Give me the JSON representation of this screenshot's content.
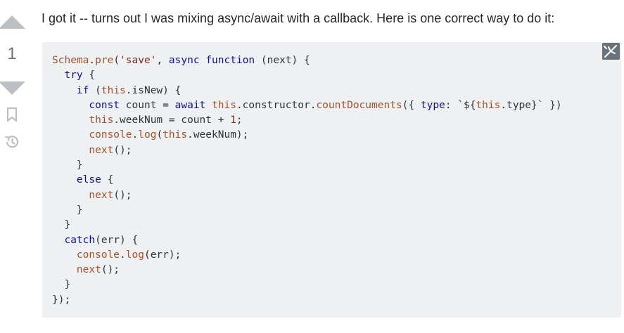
{
  "vote": {
    "count": "1"
  },
  "answer": {
    "intro": "I got it -- turns out I was mixing async/await with a callback. Here is one correct way to do it:"
  },
  "code": {
    "lines": [
      [
        [
          "fn",
          "Schema"
        ],
        [
          "v",
          "."
        ],
        [
          "fn",
          "pre"
        ],
        [
          "v",
          "("
        ],
        [
          "s",
          "'save'"
        ],
        [
          "v",
          ", "
        ],
        [
          "k",
          "async"
        ],
        [
          "v",
          " "
        ],
        [
          "k",
          "function"
        ],
        [
          "v",
          " (next) {"
        ]
      ],
      [
        [
          "v",
          "  "
        ],
        [
          "k",
          "try"
        ],
        [
          "v",
          " {"
        ]
      ],
      [
        [
          "v",
          "    "
        ],
        [
          "k",
          "if"
        ],
        [
          "v",
          " ("
        ],
        [
          "b",
          "this"
        ],
        [
          "v",
          ".isNew) {"
        ]
      ],
      [
        [
          "v",
          "      "
        ],
        [
          "k",
          "const"
        ],
        [
          "v",
          " count = "
        ],
        [
          "k",
          "await"
        ],
        [
          "v",
          " "
        ],
        [
          "b",
          "this"
        ],
        [
          "v",
          ".constructor."
        ],
        [
          "fn",
          "countDocuments"
        ],
        [
          "v",
          "({ "
        ],
        [
          "k",
          "type"
        ],
        [
          "v",
          ": `${"
        ],
        [
          "b",
          "this"
        ],
        [
          "v",
          ".type}` })"
        ]
      ],
      [
        [
          "v",
          "      "
        ],
        [
          "b",
          "this"
        ],
        [
          "v",
          ".weekNum = count + "
        ],
        [
          "n",
          "1"
        ],
        [
          "v",
          ";"
        ]
      ],
      [
        [
          "v",
          "      "
        ],
        [
          "fn",
          "console"
        ],
        [
          "v",
          "."
        ],
        [
          "fn",
          "log"
        ],
        [
          "v",
          "("
        ],
        [
          "b",
          "this"
        ],
        [
          "v",
          ".weekNum);"
        ]
      ],
      [
        [
          "v",
          "      "
        ],
        [
          "fn",
          "next"
        ],
        [
          "v",
          "();"
        ]
      ],
      [
        [
          "v",
          "    }"
        ]
      ],
      [
        [
          "v",
          "    "
        ],
        [
          "k",
          "else"
        ],
        [
          "v",
          " {"
        ]
      ],
      [
        [
          "v",
          "      "
        ],
        [
          "fn",
          "next"
        ],
        [
          "v",
          "();"
        ]
      ],
      [
        [
          "v",
          "    }"
        ]
      ],
      [
        [
          "v",
          "  }"
        ]
      ],
      [
        [
          "v",
          "  "
        ],
        [
          "k",
          "catch"
        ],
        [
          "v",
          "(err) {"
        ]
      ],
      [
        [
          "v",
          "    "
        ],
        [
          "fn",
          "console"
        ],
        [
          "v",
          "."
        ],
        [
          "fn",
          "log"
        ],
        [
          "v",
          "(err);"
        ]
      ],
      [
        [
          "v",
          "    "
        ],
        [
          "fn",
          "next"
        ],
        [
          "v",
          "();"
        ]
      ],
      [
        [
          "v",
          "  }"
        ]
      ],
      [
        [
          "v",
          "});"
        ]
      ]
    ]
  }
}
